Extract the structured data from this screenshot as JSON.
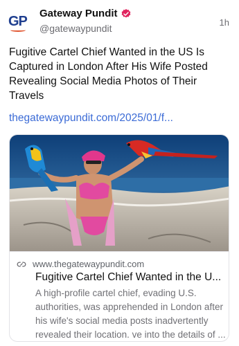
{
  "author": {
    "avatar_text": "GP",
    "display_name": "Gateway Pundit",
    "handle": "@gatewaypundit",
    "verified_icon": "verified-badge-icon"
  },
  "post": {
    "time": "1h",
    "text": "Fugitive Cartel Chief Wanted in the US Is Captured in London After His Wife Posted Revealing Social Media Photos of Their Travels",
    "link": "thegatewaypundit.com/2025/01/f..."
  },
  "card": {
    "image_description": "woman in pink bikini on beach with parrots",
    "link_icon": "link-icon",
    "domain": "www.thegatewaypundit.com",
    "title": "Fugitive Cartel Chief Wanted in the U...",
    "description": "A high-profile cartel chief, evading U.S. authorities, was apprehended in London after his wife's social media posts inadvertently revealed their location. ve into the details of ..."
  },
  "colors": {
    "link": "#3b6bd6",
    "verified": "#e0245e",
    "brand_blue": "#1f3f8f",
    "brand_orange": "#e0522c"
  }
}
